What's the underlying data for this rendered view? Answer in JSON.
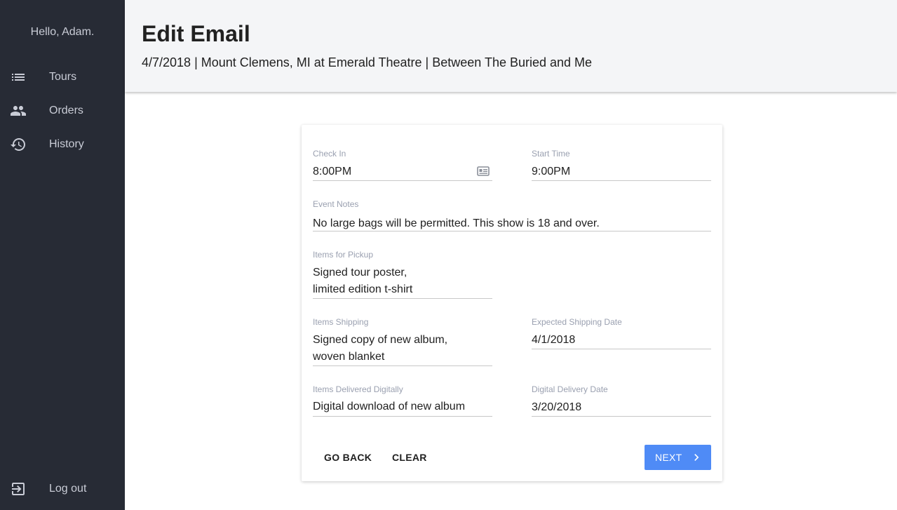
{
  "sidebar": {
    "greeting": "Hello, Adam.",
    "items": [
      {
        "label": "Tours",
        "icon": "list-icon"
      },
      {
        "label": "Orders",
        "icon": "people-icon"
      },
      {
        "label": "History",
        "icon": "history-icon"
      }
    ],
    "logout": {
      "label": "Log out",
      "icon": "logout-icon"
    }
  },
  "header": {
    "title": "Edit Email",
    "subtitle": "4/7/2018 | Mount Clemens, MI at Emerald Theatre | Between The Buried and Me"
  },
  "form": {
    "check_in": {
      "label": "Check In",
      "value": "8:00PM"
    },
    "start_time": {
      "label": "Start Time",
      "value": "9:00PM"
    },
    "event_notes": {
      "label": "Event Notes",
      "value": "No large bags will be permitted. This show is 18 and over."
    },
    "items_pickup": {
      "label": "Items for Pickup",
      "value": "Signed tour poster,\nlimited edition t-shirt"
    },
    "items_shipping": {
      "label": "Items Shipping",
      "value": "Signed copy of new album,\nwoven blanket"
    },
    "shipping_date": {
      "label": "Expected Shipping Date",
      "value": "4/1/2018"
    },
    "items_digital": {
      "label": "Items Delivered Digitally",
      "value": "Digital download of new album"
    },
    "digital_date": {
      "label": "Digital Delivery Date",
      "value": "3/20/2018"
    }
  },
  "actions": {
    "back": "GO BACK",
    "clear": "CLEAR",
    "next": "NEXT"
  },
  "colors": {
    "sidebar_bg": "#272b35",
    "header_bg": "#f4f5f7",
    "primary": "#4f8bf6"
  }
}
